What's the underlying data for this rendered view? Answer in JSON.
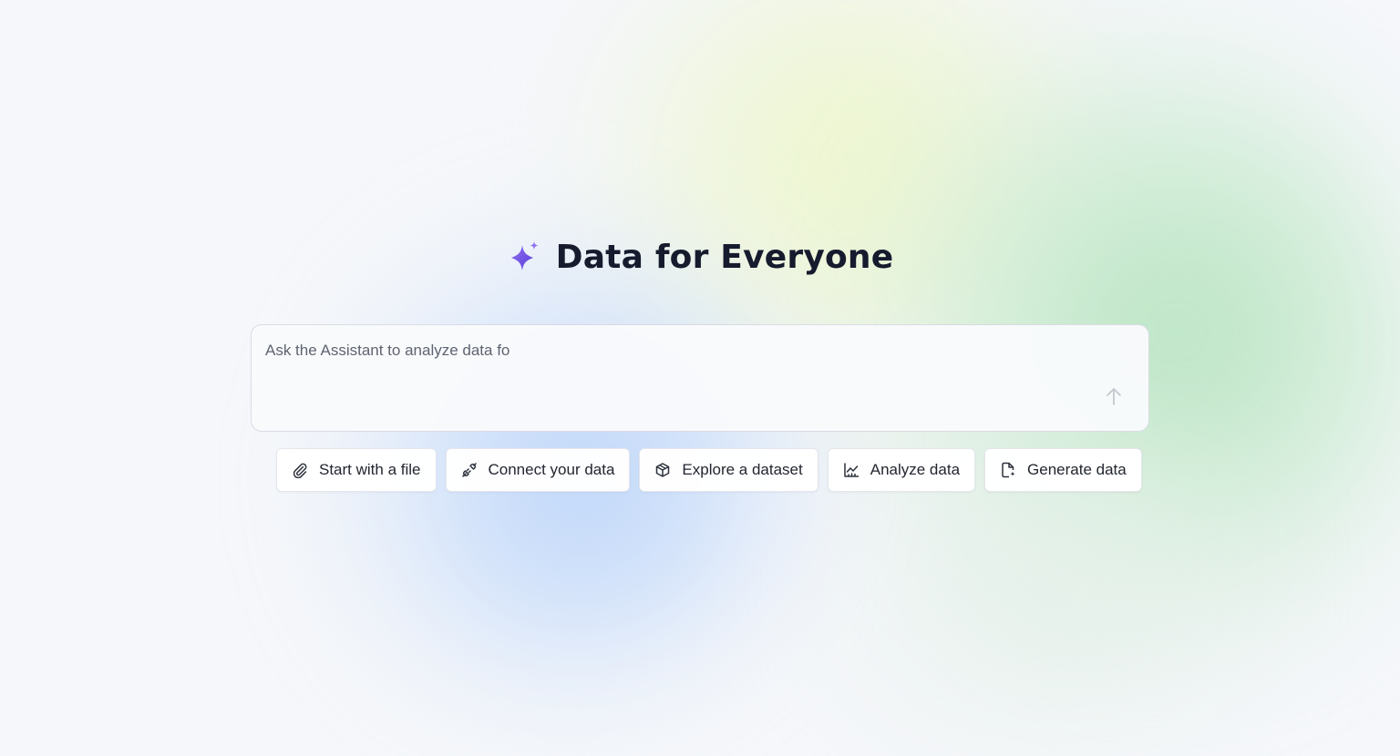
{
  "hero": {
    "title": "Data for Everyone",
    "icon": "sparkle-icon",
    "icon_colors": [
      "#6a4be6",
      "#8f6ff2"
    ]
  },
  "prompt": {
    "placeholder": "Ask the Assistant to analyze data fo",
    "value": "",
    "send_icon": "arrow-up-icon"
  },
  "chips": [
    {
      "label": "Start with a file",
      "icon": "paperclip-icon"
    },
    {
      "label": "Connect your data",
      "icon": "plug-icon"
    },
    {
      "label": "Explore a dataset",
      "icon": "cube-icon"
    },
    {
      "label": "Analyze data",
      "icon": "chart-icon"
    },
    {
      "label": "Generate data",
      "icon": "file-sparkle-icon"
    }
  ]
}
